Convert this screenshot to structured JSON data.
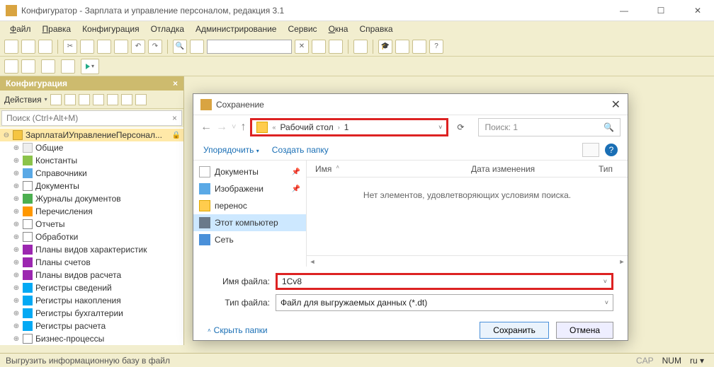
{
  "window": {
    "title": "Конфигуратор - Зарплата и управление персоналом, редакция 3.1"
  },
  "menu": {
    "items": [
      "Файл",
      "Правка",
      "Конфигурация",
      "Отладка",
      "Администрирование",
      "Сервис",
      "Окна",
      "Справка"
    ]
  },
  "config_panel": {
    "title": "Конфигурация",
    "actions_label": "Действия",
    "search_placeholder": "Поиск (Ctrl+Alt+M)",
    "root": "ЗарплатаИУправлениеПерсонал...",
    "nodes": [
      "Общие",
      "Константы",
      "Справочники",
      "Документы",
      "Журналы документов",
      "Перечисления",
      "Отчеты",
      "Обработки",
      "Планы видов характеристик",
      "Планы счетов",
      "Планы видов расчета",
      "Регистры сведений",
      "Регистры накопления",
      "Регистры бухгалтерии",
      "Регистры расчета",
      "Бизнес-процессы"
    ]
  },
  "dialog": {
    "title": "Сохранение",
    "path": {
      "seg1": "Рабочий стол",
      "seg2": "1"
    },
    "search_label": "Поиск: 1",
    "organize": "Упорядочить",
    "new_folder": "Создать папку",
    "places": {
      "docs": "Документы",
      "images": "Изображени",
      "transfer": "перенос",
      "pc": "Этот компьютер",
      "net": "Сеть"
    },
    "cols": {
      "name": "Имя",
      "modified": "Дата изменения",
      "type": "Тип"
    },
    "empty_msg": "Нет элементов, удовлетворяющих условиям поиска.",
    "filename_label": "Имя файла:",
    "filename_value": "1Cv8",
    "filetype_label": "Тип файла:",
    "filetype_value": "Файл для выгружаемых данных (*.dt)",
    "hide_folders": "Скрыть папки",
    "save_btn": "Сохранить",
    "cancel_btn": "Отмена"
  },
  "status": {
    "message": "Выгрузить информационную базу в файл",
    "cap": "CAP",
    "num": "NUM",
    "lang": "ru"
  }
}
